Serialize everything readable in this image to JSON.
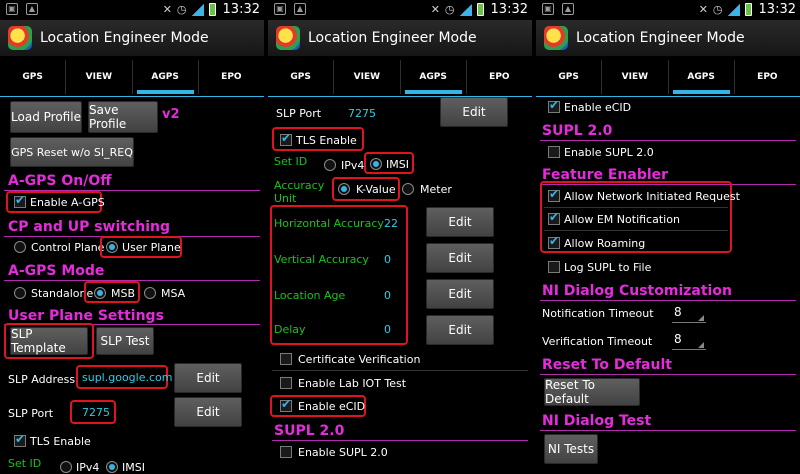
{
  "status": {
    "time": "13:32"
  },
  "app": {
    "title": "Location Engineer Mode"
  },
  "tabs": [
    "GPS",
    "VIEW",
    "AGPS",
    "EPO"
  ],
  "panel1": {
    "load_profile": "Load Profile",
    "save_profile": "Save Profile",
    "version": "v2",
    "gps_reset": "GPS Reset w/o SI_REQ",
    "agps_onoff": "A-GPS On/Off",
    "enable_agps": "Enable A-GPS",
    "cp_up": "CP and UP switching",
    "control_plane": "Control Plane",
    "user_plane": "User Plane",
    "agps_mode": "A-GPS Mode",
    "standalone": "Standalone",
    "msb": "MSB",
    "msa": "MSA",
    "user_plane_settings": "User Plane Settings",
    "slp_template": "SLP Template",
    "slp_test": "SLP Test",
    "slp_address_label": "SLP Address",
    "slp_address_value": "supl.google.com",
    "edit": "Edit",
    "slp_port_label": "SLP Port",
    "slp_port_value": "7275",
    "tls_enable": "TLS Enable",
    "set_id": "Set ID",
    "ipv4": "IPv4",
    "imsi": "IMSI"
  },
  "panel2": {
    "slp_port_label": "SLP Port",
    "slp_port_value": "7275",
    "edit": "Edit",
    "tls_enable": "TLS Enable",
    "set_id": "Set ID",
    "ipv4": "IPv4",
    "imsi": "IMSI",
    "accuracy_unit": "Accuracy Unit",
    "k_value": "K-Value",
    "meter": "Meter",
    "horizontal_accuracy": "Horizontal Accuracy",
    "horizontal_value": "22",
    "vertical_accuracy": "Vertical Accuracy",
    "vertical_value": "0",
    "location_age": "Location Age",
    "location_value": "0",
    "delay": "Delay",
    "delay_value": "0",
    "certificate_verification": "Certificate Verification",
    "enable_lab_iot": "Enable Lab IOT Test",
    "enable_ecid": "Enable eCID",
    "supl20": "SUPL 2.0",
    "enable_supl20": "Enable SUPL 2.0"
  },
  "panel3": {
    "enable_ecid": "Enable eCID",
    "supl20": "SUPL 2.0",
    "enable_supl20": "Enable SUPL 2.0",
    "feature_enabler": "Feature Enabler",
    "allow_ni": "Allow Network Initiated Request",
    "allow_em": "Allow EM Notification",
    "allow_roaming": "Allow Roaming",
    "log_supl": "Log SUPL to File",
    "ni_dialog_custom": "NI Dialog Customization",
    "notification_timeout": "Notification Timeout",
    "notification_value": "8",
    "verification_timeout": "Verification Timeout",
    "verification_value": "8",
    "reset_default_hdr": "Reset To Default",
    "reset_default_btn": "Reset To Default",
    "ni_dialog_test": "NI Dialog Test",
    "ni_tests": "NI Tests"
  }
}
